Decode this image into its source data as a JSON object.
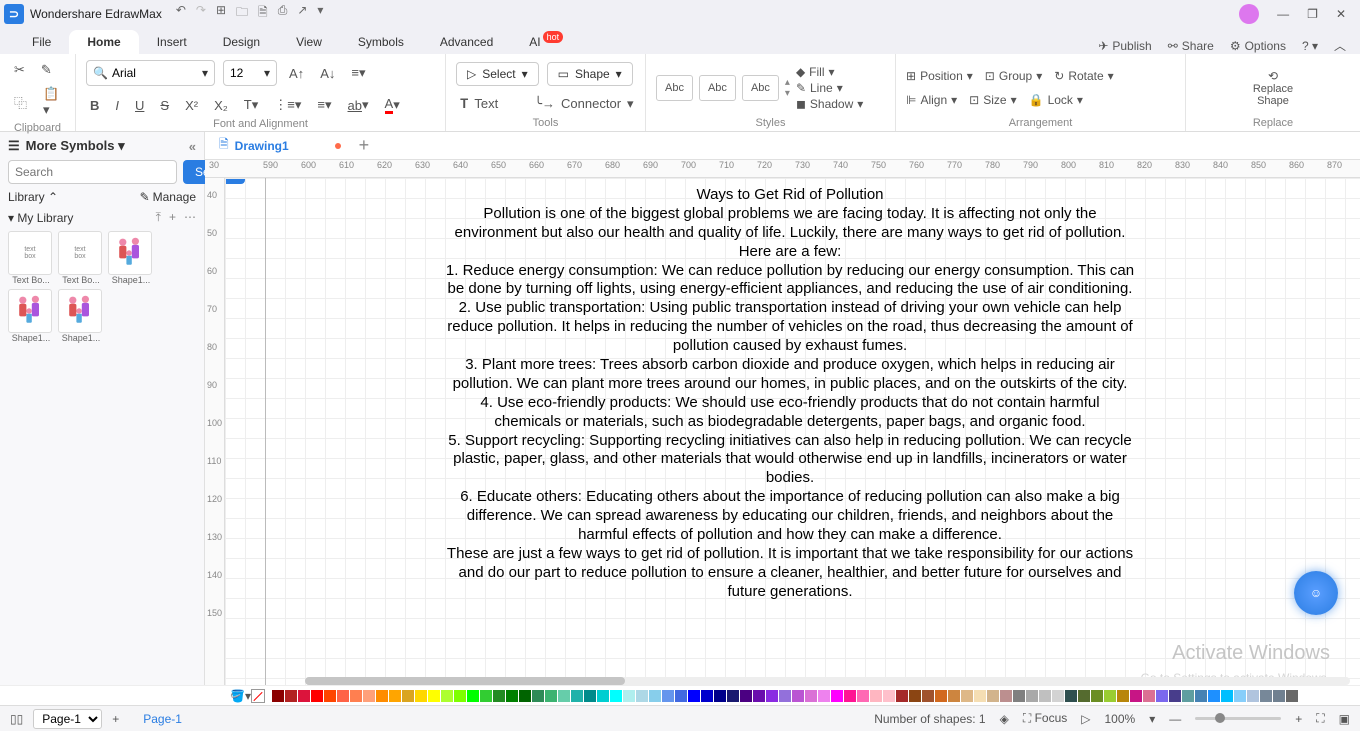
{
  "app": {
    "title": "Wondershare EdrawMax"
  },
  "menus": {
    "file": "File",
    "home": "Home",
    "insert": "Insert",
    "design": "Design",
    "view": "View",
    "symbols": "Symbols",
    "advanced": "Advanced",
    "ai": "AI",
    "hot": "hot",
    "publish": "Publish",
    "share": "Share",
    "options": "Options"
  },
  "ribbon": {
    "clipboard": "Clipboard",
    "fontalign": "Font and Alignment",
    "tools": "Tools",
    "styles": "Styles",
    "arrangement": "Arrangement",
    "replace": "Replace",
    "font": "Arial",
    "fontsize": "12",
    "select": "Select",
    "shape": "Shape",
    "text": "Text",
    "connector": "Connector",
    "fill": "Fill",
    "line": "Line",
    "shadow": "Shadow",
    "position": "Position",
    "group": "Group",
    "rotate": "Rotate",
    "align": "Align",
    "size": "Size",
    "lock": "Lock",
    "replacebtn": "Replace\nShape",
    "abc": "Abc"
  },
  "sidebar": {
    "more": "More Symbols",
    "searchPlaceholder": "Search",
    "searchBtn": "Search",
    "library": "Library",
    "manage": "Manage",
    "mylib": "My Library",
    "shapes": [
      {
        "name": "Text Bo..."
      },
      {
        "name": "Text Bo..."
      },
      {
        "name": "Shape1..."
      },
      {
        "name": "Shape1..."
      },
      {
        "name": "Shape1..."
      }
    ]
  },
  "tabs": {
    "drawing": "Drawing1"
  },
  "rulerH": [
    30,
    590,
    600,
    610,
    620,
    630,
    640,
    650,
    660,
    670,
    680,
    690,
    700,
    710,
    720,
    730,
    740,
    750,
    760,
    770,
    780,
    790,
    800,
    810,
    820,
    830,
    840,
    850,
    860,
    870
  ],
  "rulerV": [
    40,
    50,
    60,
    70,
    80,
    90,
    100,
    110,
    120,
    130,
    140,
    150
  ],
  "document": {
    "title": "Ways to Get Rid of Pollution",
    "p1": "Pollution is one of the biggest global problems we are facing today. It is affecting not only the environment but also our health and quality of life. Luckily, there are many ways to get rid of pollution. Here are a few:",
    "p2": "1. Reduce energy consumption: We can reduce pollution by reducing our energy consumption. This can be done by turning off lights, using energy-efficient appliances, and reducing the use of air conditioning.",
    "p3": "2. Use public transportation: Using public transportation instead of driving your own vehicle can help reduce pollution. It helps in reducing the number of vehicles on the road, thus decreasing the amount of pollution caused by exhaust fumes.",
    "p4": "3. Plant more trees: Trees absorb carbon dioxide and produce oxygen, which helps in reducing air pollution. We can plant more trees around our homes, in public places, and on the outskirts of the city.",
    "p5": "4. Use eco-friendly products: We should use eco-friendly products that do not contain harmful chemicals or materials, such as biodegradable detergents, paper bags, and organic food.",
    "p6": "5. Support recycling: Supporting recycling initiatives can also help in reducing pollution. We can recycle plastic, paper, glass, and other materials that would otherwise end up in landfills, incinerators or water bodies.",
    "p7": "6. Educate others: Educating others about the importance of reducing pollution can also make a big difference. We can spread awareness by educating our children, friends, and neighbors about the harmful effects of pollution and how they can make a difference.",
    "p8": "These are just a few ways to get rid of pollution. It is important that we take responsibility for our actions and do our part to reduce pollution to ensure a cleaner, healthier, and better future for ourselves and future generations."
  },
  "status": {
    "page": "Page-1",
    "pageSel": "Page-1",
    "shapes": "Number of shapes: 1",
    "focus": "Focus",
    "zoom": "100%"
  },
  "watermark": {
    "line1": "Activate Windows",
    "line2": "Go to Settings to activate Windows."
  },
  "colors": [
    "#8b0000",
    "#b22222",
    "#dc143c",
    "#ff0000",
    "#ff4500",
    "#ff6347",
    "#ff7f50",
    "#ffa07a",
    "#ff8c00",
    "#ffa500",
    "#daa520",
    "#ffd700",
    "#ffff00",
    "#adff2f",
    "#7fff00",
    "#00ff00",
    "#32cd32",
    "#228b22",
    "#008000",
    "#006400",
    "#2e8b57",
    "#3cb371",
    "#66cdaa",
    "#20b2aa",
    "#008b8b",
    "#00ced1",
    "#00ffff",
    "#afeeee",
    "#add8e6",
    "#87ceeb",
    "#6495ed",
    "#4169e1",
    "#0000ff",
    "#0000cd",
    "#00008b",
    "#191970",
    "#4b0082",
    "#6a0dad",
    "#8a2be2",
    "#9370db",
    "#ba55d3",
    "#da70d6",
    "#ee82ee",
    "#ff00ff",
    "#ff1493",
    "#ff69b4",
    "#ffb6c1",
    "#ffc0cb",
    "#a52a2a",
    "#8b4513",
    "#a0522d",
    "#d2691e",
    "#cd853f",
    "#deb887",
    "#f5deb3",
    "#d2b48c",
    "#bc8f8f",
    "#808080",
    "#a9a9a9",
    "#c0c0c0",
    "#d3d3d3",
    "#2f4f4f",
    "#556b2f",
    "#6b8e23",
    "#9acd32",
    "#b8860b",
    "#c71585",
    "#db7093",
    "#7b68ee",
    "#483d8b",
    "#5f9ea0",
    "#4682b4",
    "#1e90ff",
    "#00bfff",
    "#87cefa",
    "#b0c4de",
    "#778899",
    "#708090",
    "#696969"
  ]
}
